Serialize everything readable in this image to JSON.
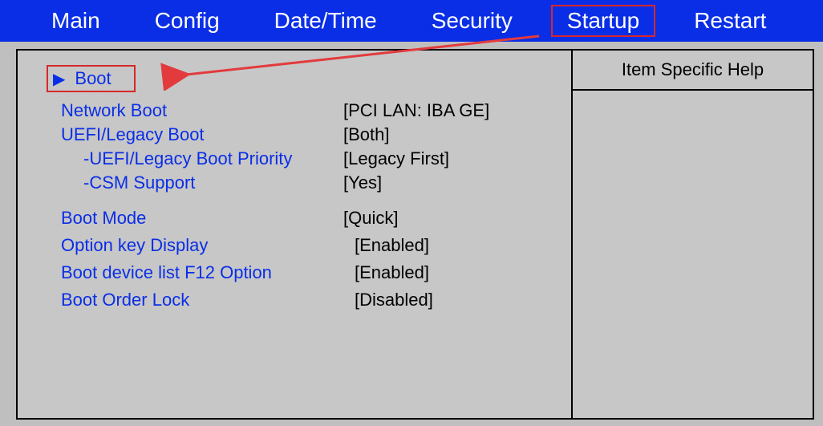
{
  "menu": {
    "items": [
      "Main",
      "Config",
      "Date/Time",
      "Security",
      "Startup",
      "Restart"
    ],
    "active_index": 4
  },
  "help": {
    "title": "Item Specific Help"
  },
  "boot_caret": "▶",
  "boot_label": "Boot",
  "settings": [
    {
      "label": "Network Boot",
      "value": "[PCI LAN: IBA GE]",
      "indent": 0
    },
    {
      "label": "UEFI/Legacy Boot",
      "value": "[Both]",
      "indent": 0
    },
    {
      "label": "-UEFI/Legacy Boot Priority",
      "value": "[Legacy First]",
      "indent": 1
    },
    {
      "label": "-CSM Support",
      "value": "[Yes]",
      "indent": 1
    }
  ],
  "settings2": [
    {
      "label": "Boot Mode",
      "value": "[Quick]"
    },
    {
      "label": "Option key Display",
      "value": "[Enabled]"
    },
    {
      "label": "Boot device list F12 Option",
      "value": "[Enabled]"
    },
    {
      "label": "Boot Order Lock",
      "value": "[Disabled]"
    }
  ]
}
